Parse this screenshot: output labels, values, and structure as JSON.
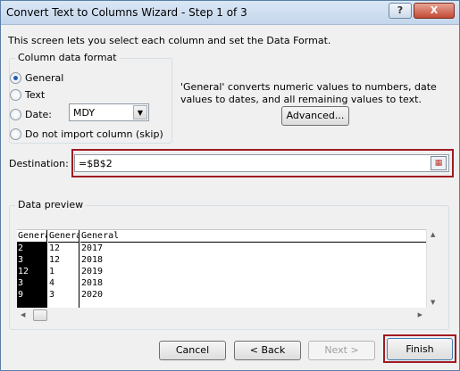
{
  "window": {
    "title": "Convert Text to Columns Wizard - Step 1 of 3",
    "help_label": "?",
    "close_label": "X"
  },
  "intro_text": "This screen lets you select each column and set the Data Format.",
  "column_format": {
    "group_label": "Column data format",
    "options": [
      "General",
      "Text",
      "Date:",
      "Do not import column (skip)"
    ],
    "selected": "General",
    "date_value": "MDY"
  },
  "description": "'General' converts numeric values to numbers, date values to dates, and all remaining values to text.",
  "advanced_label": "Advanced...",
  "destination": {
    "label": "Destination:",
    "value": "=$B$2"
  },
  "preview": {
    "label": "Data preview",
    "columns": [
      {
        "header": "General",
        "cells": [
          "2",
          "3",
          "12",
          "3",
          "9"
        ],
        "selected": true
      },
      {
        "header": "General",
        "cells": [
          "12",
          "12",
          "1",
          "4",
          "3"
        ],
        "selected": false
      },
      {
        "header": "General",
        "cells": [
          "2017",
          "2018",
          "2019",
          "2018",
          "2020"
        ],
        "selected": false
      }
    ]
  },
  "buttons": {
    "cancel": "Cancel",
    "back": "< Back",
    "next": "Next >",
    "finish": "Finish"
  },
  "colors": {
    "highlight": "#a01a22"
  }
}
